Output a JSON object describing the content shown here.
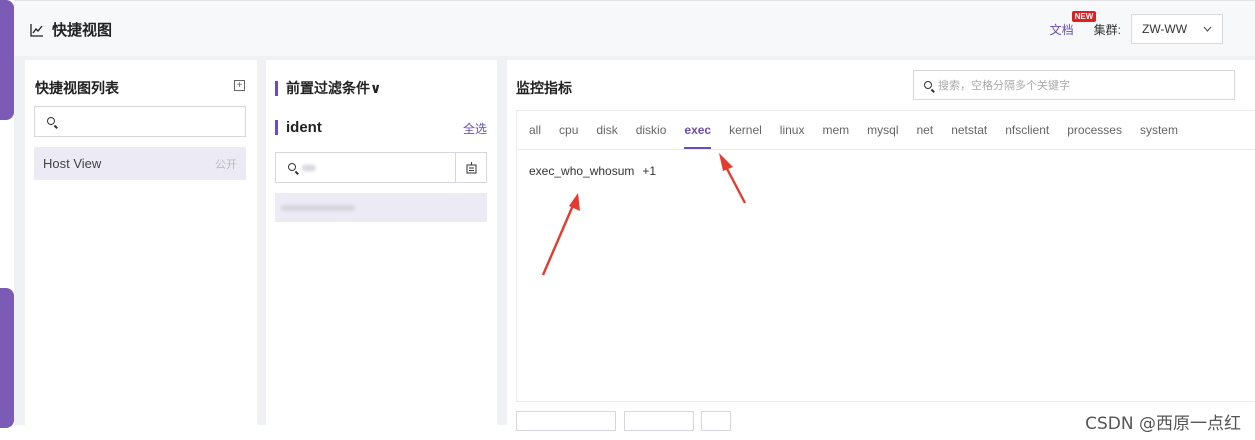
{
  "header": {
    "title": "快捷视图",
    "doc_link": "文档",
    "new_badge": "NEW",
    "cluster_label": "集群:",
    "cluster_value": "ZW-WW"
  },
  "quick_views": {
    "title": "快捷视图列表",
    "items": [
      {
        "name": "Host View",
        "tag": "公开"
      }
    ]
  },
  "filters": {
    "title": "前置过滤条件∨",
    "ident_label": "ident",
    "select_all": "全选",
    "search_value": "",
    "items": [
      ""
    ]
  },
  "metrics": {
    "title": "监控指标",
    "search_placeholder": "搜索，空格分隔多个关键字",
    "tabs": [
      "all",
      "cpu",
      "disk",
      "diskio",
      "exec",
      "kernel",
      "linux",
      "mem",
      "mysql",
      "net",
      "netstat",
      "nfsclient",
      "processes",
      "system"
    ],
    "active_tab": "exec",
    "rows": [
      {
        "name": "exec_who_whosum",
        "extra": "+1"
      }
    ]
  },
  "annotation": {
    "arrow_color": "#e53a2f"
  },
  "watermark": "CSDN @西原一点红",
  "colors": {
    "accent": "#6a4dbb",
    "side_bar": "#7b5bb5",
    "selected_bg": "#ecebf5"
  }
}
